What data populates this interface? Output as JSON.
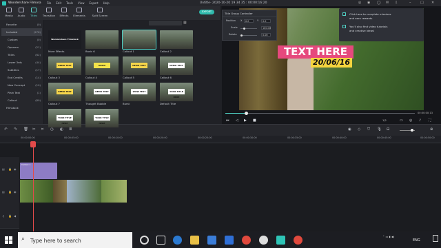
{
  "app": {
    "name": "Wondershare Filmora",
    "menu": [
      "File",
      "Edit",
      "Tools",
      "View",
      "Export",
      "Help"
    ],
    "document_title": "Untitle- 2020-10-20 19 34 35 : 00:00:16:20"
  },
  "toolbar": {
    "tabs": [
      {
        "label": "Media",
        "icon": "folder-icon"
      },
      {
        "label": "Audio",
        "icon": "music-note-icon"
      },
      {
        "label": "Titles",
        "icon": "text-icon",
        "active": true
      },
      {
        "label": "Transition",
        "icon": "transition-icon"
      },
      {
        "label": "Effects",
        "icon": "effects-icon"
      },
      {
        "label": "Elements",
        "icon": "elements-icon"
      },
      {
        "label": "Split Screen",
        "icon": "split-screen-icon"
      }
    ],
    "export_label": "EXPORT"
  },
  "categories": [
    {
      "label": "Favorite",
      "count": "(0)"
    },
    {
      "label": "Included",
      "count": "(276)",
      "selected": true
    },
    {
      "label": "Custom",
      "count": "(0)"
    },
    {
      "label": "Openers",
      "count": "(21)"
    },
    {
      "label": "Titles",
      "count": "(62)"
    },
    {
      "label": "Lower 3rds",
      "count": "(44)"
    },
    {
      "label": "Subtitles",
      "count": "(17)"
    },
    {
      "label": "End Credits",
      "count": "(14)"
    },
    {
      "label": "New Concept",
      "count": "(10)"
    },
    {
      "label": "Plain Text",
      "count": "(1)"
    },
    {
      "label": "Callout",
      "count": "(80)"
    },
    {
      "label": "Filmstock",
      "count": ""
    }
  ],
  "media_items": [
    {
      "label": "More Effects",
      "tag": "Wondershare Filmstock"
    },
    {
      "label": "Basic 6",
      "tag": ""
    },
    {
      "label": "Callout 1",
      "tag": "",
      "selected": true
    },
    {
      "label": "Callout 2",
      "tag": ""
    },
    {
      "label": "Callout 3",
      "tag": "DEMO TEXT"
    },
    {
      "label": "Callout 4",
      "tag": "DEMO"
    },
    {
      "label": "Callout 5",
      "tag": "DEMO TEXT"
    },
    {
      "label": "Callout 6",
      "tag": "DEMO TEXT"
    },
    {
      "label": "Callout 7",
      "tag": "DEMO TEXT"
    },
    {
      "label": "Thought Bubble",
      "tag": "DEMO TEXT"
    },
    {
      "label": "Burst",
      "tag": "WOW TEXT"
    },
    {
      "label": "Default Title",
      "tag": "YOUR TITLE HERE"
    },
    {
      "label": "",
      "tag": "YOUR TITLE HERE"
    },
    {
      "label": "",
      "tag": "YOUR TITLE HERE"
    }
  ],
  "title_controller": {
    "header": "Title Group Controller",
    "position_label": "Position",
    "pos_x": "0.0",
    "pos_y": "0.0",
    "x_label": "X",
    "y_label": "Y",
    "scale_label": "Scale",
    "scale_value": "100.00",
    "rotate_label": "Rotate",
    "rotate_value": "0.00"
  },
  "notification": {
    "line1a": "Click here to complete missions",
    "line1b": "and earn rewards.",
    "line2a": "You'll also find video tutorials",
    "line2b": "and creative ideas!"
  },
  "preview": {
    "title_text": "TEXT HERE",
    "date_text": "20/06/16",
    "time": "00:00:00:13",
    "ratio": "1/2",
    "progress": 0.1
  },
  "timeline": {
    "ruler": [
      "00:00:00:00",
      "00:00:05:00",
      "00:00:10:00",
      "00:00:16:20",
      "00:00:20:00",
      "00:00:25:00",
      "00:00:30:00",
      "00:00:35:00",
      "00:00:40:00",
      "00:00:45:00",
      "00:00:50:00"
    ],
    "title_clip_label": "Callout 1"
  },
  "taskbar": {
    "search_placeholder": "Type here to search",
    "language": "ENG"
  }
}
